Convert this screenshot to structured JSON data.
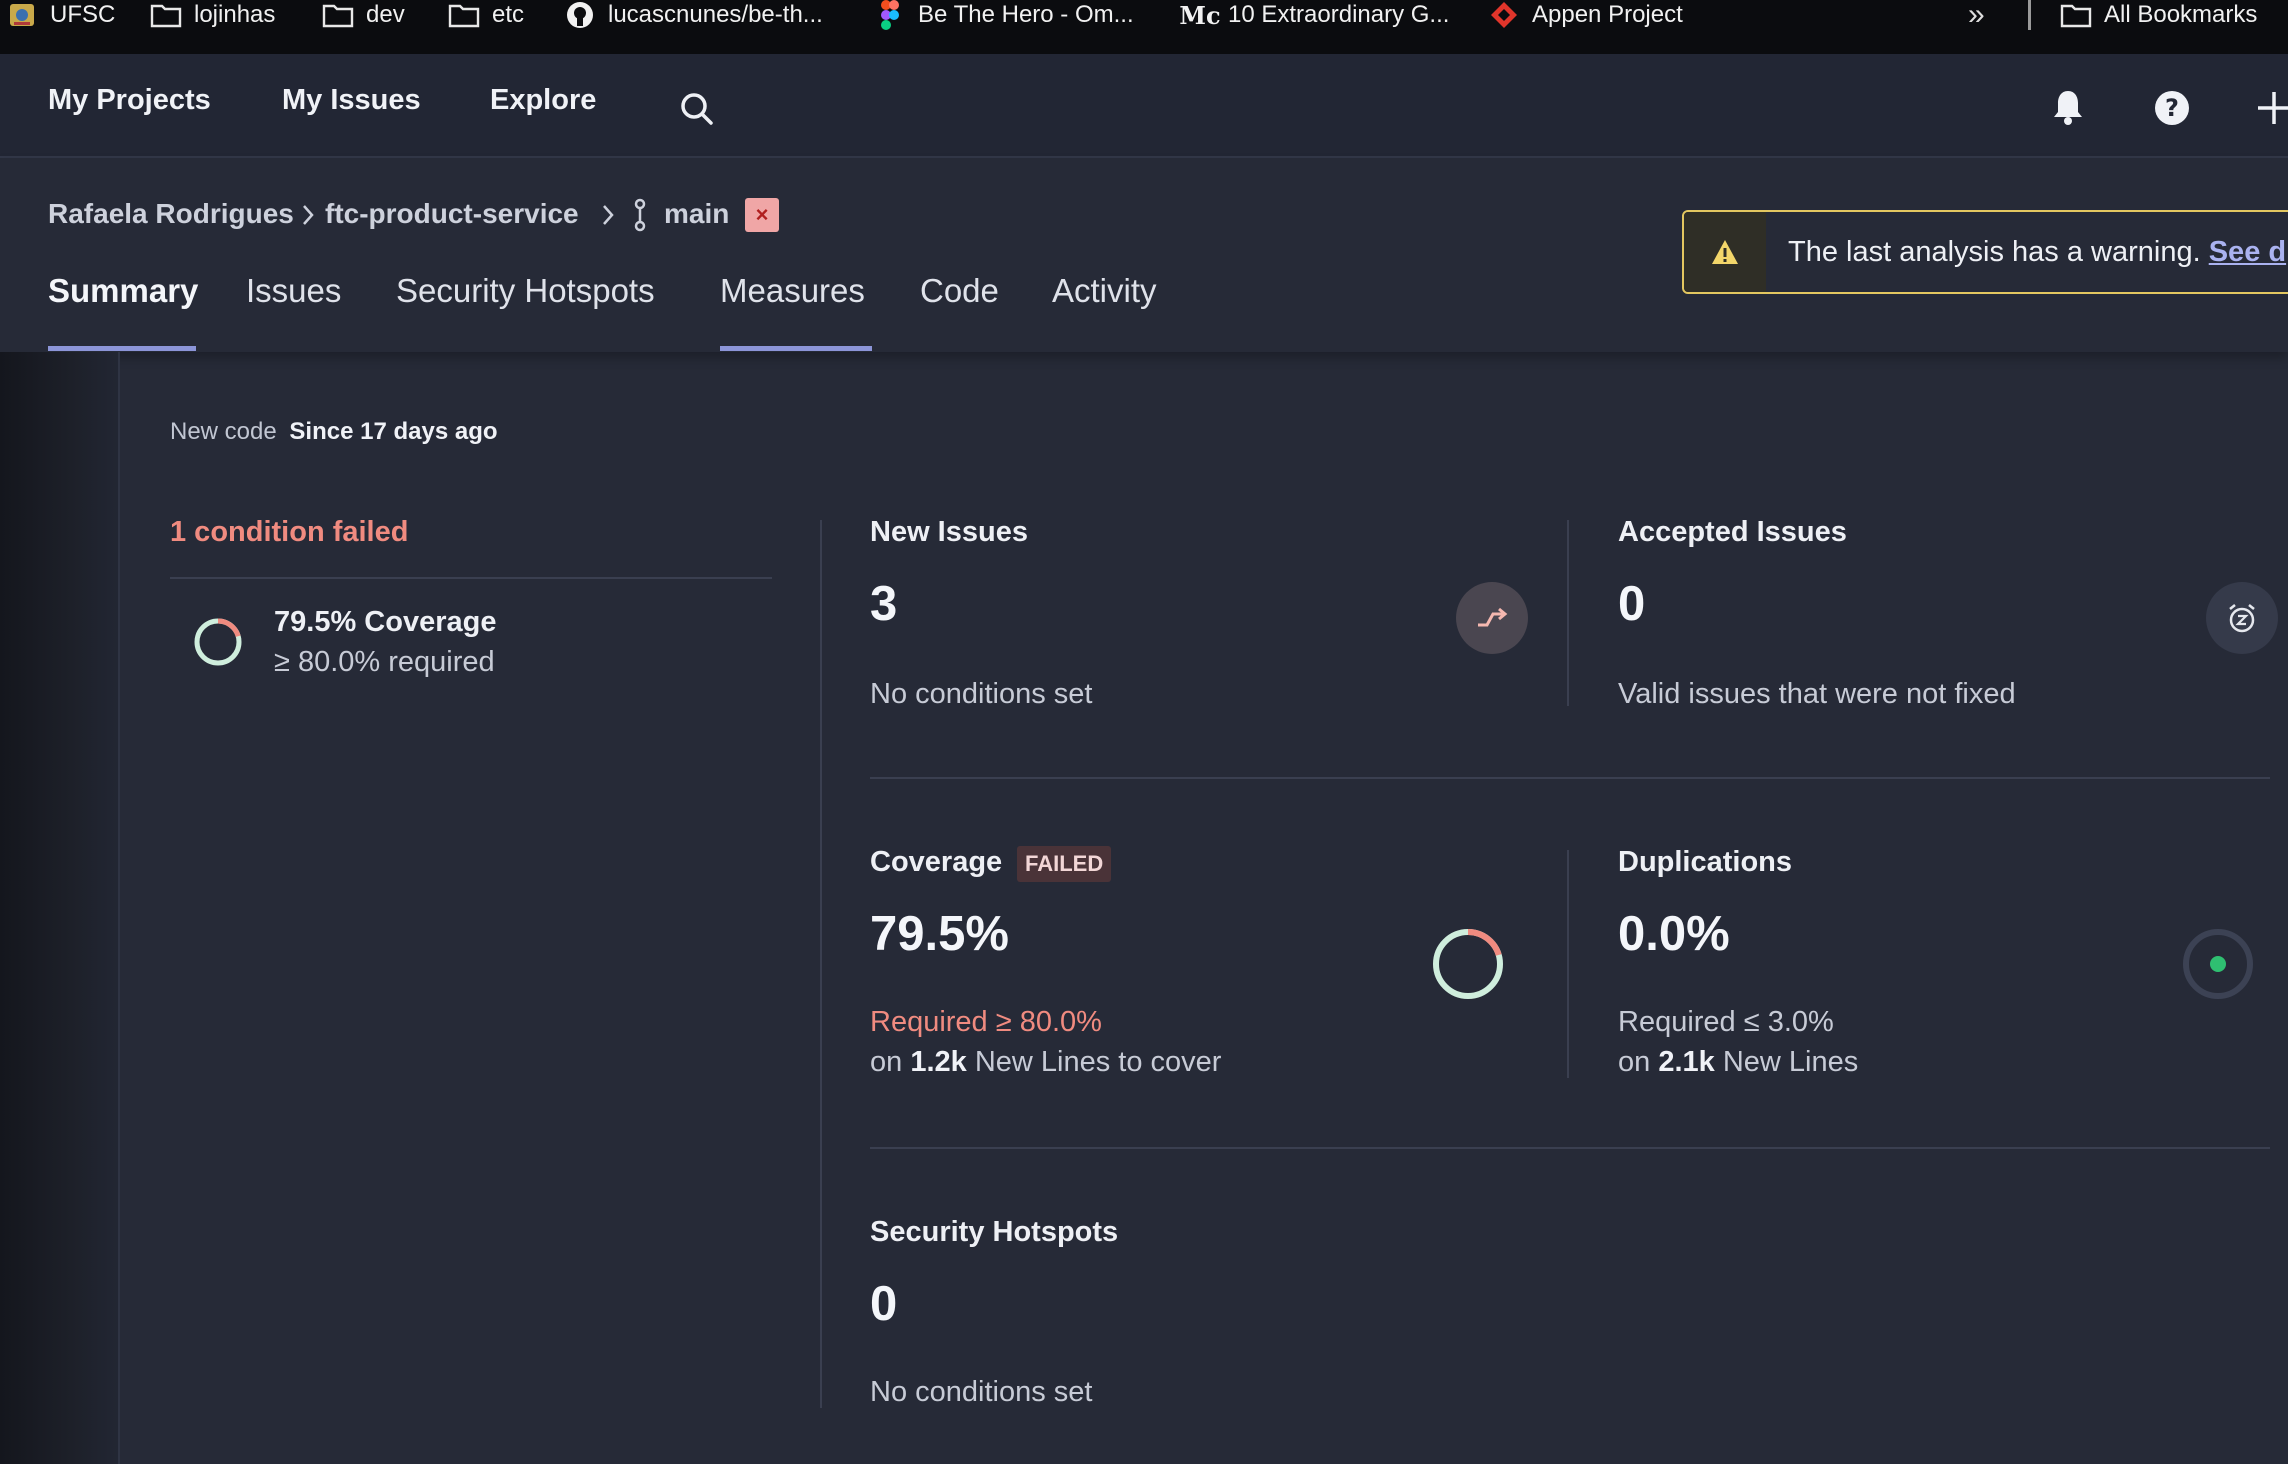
{
  "bookmarks": [
    {
      "label": "UFSC",
      "icon": "university-logo-icon"
    },
    {
      "label": "lojinhas",
      "icon": "folder-icon"
    },
    {
      "label": "dev",
      "icon": "folder-icon"
    },
    {
      "label": "etc",
      "icon": "folder-icon"
    },
    {
      "label": "lucascnunes/be-th...",
      "icon": "github-icon"
    },
    {
      "label": "Be The Hero - Om...",
      "icon": "figma-icon"
    },
    {
      "label": "10 Extraordinary G...",
      "icon": "medium-icon"
    },
    {
      "label": "Appen Project",
      "icon": "appen-icon"
    }
  ],
  "bookmarks_more": "»",
  "all_bookmarks": "All Bookmarks",
  "nav": {
    "my_projects": "My Projects",
    "my_issues": "My Issues",
    "explore": "Explore"
  },
  "breadcrumb": {
    "owner": "Rafaela Rodrigues",
    "project": "ftc-product-service",
    "branch": "main",
    "branch_close": "×"
  },
  "tabs": [
    "Summary",
    "Issues",
    "Security Hotspots",
    "Measures",
    "Code",
    "Activity"
  ],
  "active_tab": "Summary",
  "warning": {
    "text": "The last analysis has a warning.",
    "link": "See d"
  },
  "new_code": {
    "label": "New code",
    "value": "Since 17 days ago"
  },
  "conditions": {
    "failed_text": "1 condition failed",
    "items": [
      {
        "title": "79.5% Coverage",
        "requirement": "≥ 80.0% required"
      }
    ]
  },
  "measures": {
    "new_issues": {
      "title": "New Issues",
      "value": "3",
      "desc": "No conditions set"
    },
    "accepted_issues": {
      "title": "Accepted Issues",
      "value": "0",
      "desc": "Valid issues that were not fixed"
    },
    "coverage": {
      "title": "Coverage",
      "badge": "FAILED",
      "value": "79.5%",
      "required": "Required ≥ 80.0%",
      "on": "on",
      "amount": "1.2k",
      "suffix": "New Lines to cover",
      "fraction": 0.795
    },
    "duplications": {
      "title": "Duplications",
      "value": "0.0%",
      "required": "Required ≤ 3.0%",
      "on": "on",
      "amount": "2.1k",
      "suffix": "New Lines"
    },
    "security_hotspots": {
      "title": "Security Hotspots",
      "value": "0",
      "desc": "No conditions set"
    }
  },
  "colors": {
    "background": "#262a37",
    "failed_red": "#f08b80",
    "pass_green": "#2fbf71",
    "accent": "#8c95d8",
    "warning_yellow": "#e3c760"
  }
}
